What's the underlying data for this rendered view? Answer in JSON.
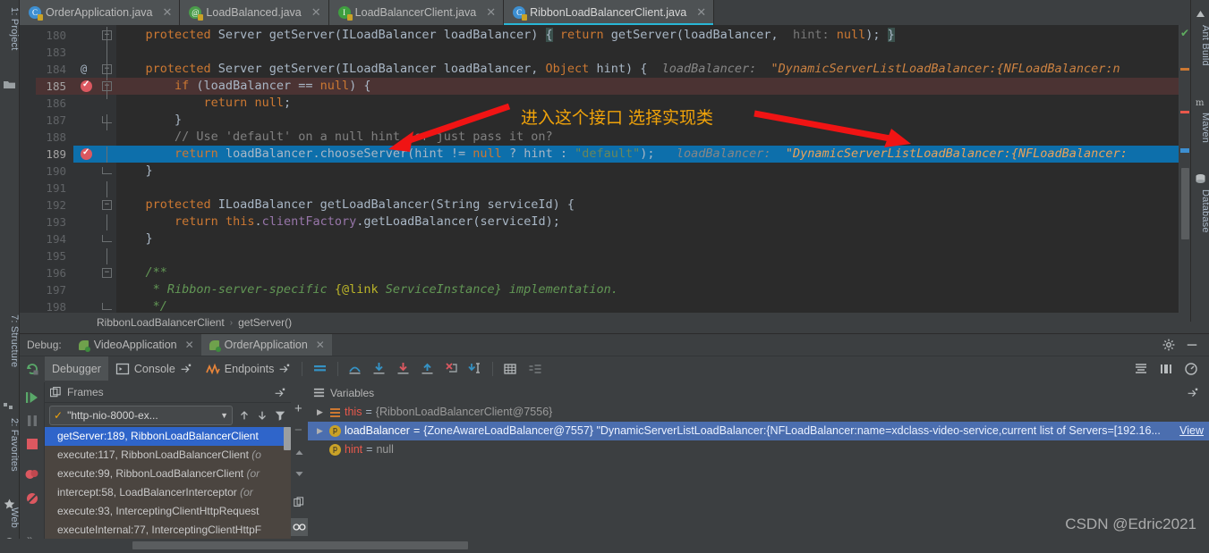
{
  "window": {
    "watermark": "CSDN @Edric2021"
  },
  "left_strip": {
    "items": [
      {
        "label": "1: Project",
        "icon": "folder-icon"
      },
      {
        "label": "7: Structure",
        "icon": "structure-icon"
      },
      {
        "label": "2: Favorites",
        "icon": "star-icon"
      },
      {
        "label": "Web",
        "icon": "globe-icon"
      }
    ]
  },
  "right_strip": {
    "items": [
      {
        "label": "Ant Build",
        "icon": "ant-icon"
      },
      {
        "label": "Maven",
        "icon": "maven-icon"
      },
      {
        "label": "Database",
        "icon": "database-icon"
      }
    ]
  },
  "tabs": [
    {
      "label": "OrderApplication.java",
      "icon": "spring-class-icon",
      "glyph": "C",
      "active": false
    },
    {
      "label": "LoadBalanced.java",
      "icon": "annotation-icon",
      "glyph": "@",
      "active": false
    },
    {
      "label": "LoadBalancerClient.java",
      "icon": "interface-icon",
      "glyph": "I",
      "active": false
    },
    {
      "label": "RibbonLoadBalancerClient.java",
      "icon": "class-icon",
      "glyph": "C",
      "active": true
    }
  ],
  "editor": {
    "lines": [
      {
        "num": "180",
        "fold": "plus",
        "marker": "",
        "segments": [
          {
            "t": "    ",
            "c": "id"
          },
          {
            "t": "protected",
            "c": "k"
          },
          {
            "t": " Server getServer(ILoadBalancer loadBalancer) ",
            "c": "id"
          },
          {
            "t": "{",
            "c": "brmatch"
          },
          {
            "t": " ",
            "c": "id"
          },
          {
            "t": "return",
            "c": "k"
          },
          {
            "t": " getServer(loadBalancer, ",
            "c": "id"
          },
          {
            "t": " hint:",
            "c": "hintp"
          },
          {
            "t": " ",
            "c": "id"
          },
          {
            "t": "null",
            "c": "k"
          },
          {
            "t": "); ",
            "c": "id"
          },
          {
            "t": "}",
            "c": "brmatch"
          }
        ]
      },
      {
        "num": "183",
        "fold": "",
        "marker": "",
        "segments": []
      },
      {
        "num": "184",
        "fold": "minus",
        "marker": "at",
        "segments": [
          {
            "t": "    ",
            "c": "id"
          },
          {
            "t": "protected",
            "c": "k"
          },
          {
            "t": " Server getServer(ILoadBalancer loadBalancer, ",
            "c": "id"
          },
          {
            "t": "Object",
            "c": "k"
          },
          {
            "t": " hint) {  ",
            "c": "id"
          },
          {
            "t": "loadBalancer:",
            "c": "dbg"
          },
          {
            "t": "  \"DynamicServerListLoadBalancer:{NFLoadBalancer:n",
            "c": "dbgv"
          }
        ]
      },
      {
        "num": "185",
        "fold": "minus",
        "marker": "breakpoint",
        "hl": "red",
        "segments": [
          {
            "t": "        ",
            "c": "id"
          },
          {
            "t": "if",
            "c": "k"
          },
          {
            "t": " (loadBalancer == ",
            "c": "id"
          },
          {
            "t": "null",
            "c": "k"
          },
          {
            "t": ") {",
            "c": "id"
          }
        ]
      },
      {
        "num": "186",
        "fold": "",
        "marker": "",
        "segments": [
          {
            "t": "            ",
            "c": "id"
          },
          {
            "t": "return",
            "c": "k"
          },
          {
            "t": " ",
            "c": "id"
          },
          {
            "t": "null",
            "c": "k"
          },
          {
            "t": ";",
            "c": "id"
          }
        ]
      },
      {
        "num": "187",
        "fold": "foldend",
        "marker": "",
        "segments": [
          {
            "t": "        }",
            "c": "id"
          }
        ]
      },
      {
        "num": "188",
        "fold": "",
        "marker": "",
        "segments": [
          {
            "t": "        ",
            "c": "id"
          },
          {
            "t": "// Use 'default' on a null hint, or just pass it on?",
            "c": "cmt"
          }
        ]
      },
      {
        "num": "189",
        "fold": "",
        "marker": "breakpoint",
        "hl": "blue",
        "segments": [
          {
            "t": "        ",
            "c": "id"
          },
          {
            "t": "return",
            "c": "k"
          },
          {
            "t": " loadBalancer.chooseServer(hint != ",
            "c": "id"
          },
          {
            "t": "null",
            "c": "k"
          },
          {
            "t": " ? hint : ",
            "c": "id"
          },
          {
            "t": "\"default\"",
            "c": "str"
          },
          {
            "t": ");   ",
            "c": "id"
          },
          {
            "t": "loadBalancer:",
            "c": "dbg"
          },
          {
            "t": "  \"DynamicServerListLoadBalancer:{NFLoadBalancer:",
            "c": "dbgv-sel"
          }
        ]
      },
      {
        "num": "190",
        "fold": "foldend",
        "marker": "",
        "segments": [
          {
            "t": "    }",
            "c": "id"
          }
        ]
      },
      {
        "num": "191",
        "fold": "",
        "marker": "",
        "segments": []
      },
      {
        "num": "192",
        "fold": "minus",
        "marker": "",
        "segments": [
          {
            "t": "    ",
            "c": "id"
          },
          {
            "t": "protected",
            "c": "k"
          },
          {
            "t": " ILoadBalancer getLoadBalancer(String serviceId) {",
            "c": "id"
          }
        ]
      },
      {
        "num": "193",
        "fold": "",
        "marker": "",
        "segments": [
          {
            "t": "        ",
            "c": "id"
          },
          {
            "t": "return",
            "c": "k"
          },
          {
            "t": " ",
            "c": "id"
          },
          {
            "t": "this",
            "c": "k"
          },
          {
            "t": ".",
            "c": "id"
          },
          {
            "t": "clientFactory",
            "c": "fld"
          },
          {
            "t": ".getLoadBalancer(serviceId);",
            "c": "id"
          }
        ]
      },
      {
        "num": "194",
        "fold": "foldend",
        "marker": "",
        "segments": [
          {
            "t": "    }",
            "c": "id"
          }
        ]
      },
      {
        "num": "195",
        "fold": "",
        "marker": "",
        "segments": []
      },
      {
        "num": "196",
        "fold": "minus",
        "marker": "",
        "segments": [
          {
            "t": "    /**",
            "c": "cm"
          }
        ]
      },
      {
        "num": "197",
        "fold": "",
        "marker": "",
        "segments": [
          {
            "t": "     * Ribbon-server-specific ",
            "c": "cm"
          },
          {
            "t": "{@link",
            "c": "annot"
          },
          {
            "t": " ServiceInstance} implementation.",
            "c": "cm"
          }
        ]
      },
      {
        "num": "198",
        "fold": "foldend",
        "marker": "",
        "segments": [
          {
            "t": "     */",
            "c": "cm"
          }
        ]
      }
    ]
  },
  "breadcrumb": {
    "class": "RibbonLoadBalancerClient",
    "separator": "›",
    "method": "getServer()"
  },
  "debug_bar": {
    "label": "Debug:",
    "tabs": [
      {
        "label": "VideoApplication",
        "active": false
      },
      {
        "label": "OrderApplication",
        "active": true
      }
    ],
    "settings_icon": "gear-icon",
    "minimize_icon": "minimize-icon"
  },
  "debug_toolbar": {
    "rerun_icon": "rerun-icon",
    "items": [
      {
        "label": "Debugger",
        "icon": "debugger-icon",
        "active": true
      },
      {
        "label": "Console",
        "icon": "console-icon",
        "active": false
      },
      {
        "label": "Endpoints",
        "icon": "endpoints-icon",
        "active": false
      }
    ],
    "action_icons": [
      "show-execution-point-icon",
      "step-over-icon",
      "step-into-icon",
      "force-step-into-icon",
      "step-out-icon",
      "drop-frame-icon",
      "run-to-cursor-icon",
      "evaluate-expression-icon",
      "layout-icon"
    ],
    "right_icons": [
      "restore-layout-icon",
      "settings-layout-icon",
      "mute-breakpoints-icon"
    ]
  },
  "run_controls": {
    "icons": [
      "resume-program-icon",
      "pause-program-icon",
      "stop-icon",
      "view-breakpoints-icon",
      "mute-breakpoints-icon",
      "more-icon"
    ]
  },
  "frames_panel": {
    "title": "Frames",
    "icon": "frames-icon",
    "settings_icon": "pin-icon",
    "thread": {
      "status_icon": "check-icon",
      "value": "\"http-nio-8000-ex...",
      "dropdown_icon": "chevron-down-icon"
    },
    "toolbar_icons": [
      "arrow-up-icon",
      "arrow-down-icon",
      "filter-icon"
    ],
    "frames": [
      {
        "method": "getServer:189, RibbonLoadBalancerClient",
        "detail": "",
        "selected": true
      },
      {
        "method": "execute:117, RibbonLoadBalancerClient ",
        "detail": "(o",
        "selected": false
      },
      {
        "method": "execute:99, RibbonLoadBalancerClient ",
        "detail": "(or",
        "selected": false
      },
      {
        "method": "intercept:58, LoadBalancerInterceptor ",
        "detail": "(or",
        "selected": false
      },
      {
        "method": "execute:93, InterceptingClientHttpRequest",
        "detail": "",
        "selected": false
      },
      {
        "method": "executeInternal:77, InterceptingClientHttpF",
        "detail": "",
        "selected": false
      }
    ]
  },
  "variables_panel": {
    "title": "Variables",
    "pin_icon": "pin-icon",
    "side_icons": [
      "add-watch-icon",
      "remove-watch-icon",
      "up-icon",
      "down-icon",
      "copy-icon",
      "inspect-icon"
    ],
    "variables": [
      {
        "expandable": true,
        "icon": "list-icon",
        "name": "this",
        "eq": "=",
        "value": "{RibbonLoadBalancerClient@7556}",
        "selected": false,
        "view_link": ""
      },
      {
        "expandable": true,
        "icon": "p-icon",
        "name": "loadBalancer",
        "eq": "=",
        "value": "{ZoneAwareLoadBalancer@7557} \"DynamicServerListLoadBalancer:{NFLoadBalancer:name=xdclass-video-service,current list of Servers=[192.16...",
        "selected": true,
        "view_link": "View"
      },
      {
        "expandable": false,
        "icon": "p-icon",
        "name": "hint",
        "eq": "=",
        "value": "null",
        "selected": false,
        "view_link": ""
      }
    ]
  },
  "annotation": {
    "text": "进入这个接口 选择实现类",
    "color": "#f0a30a",
    "arrow_color": "#f01414"
  },
  "colors": {
    "editor_bg": "#2b2b2b",
    "panel_bg": "#3c3f41",
    "gutter_bg": "#313335",
    "selection_blue": "#0d6fab",
    "breakpoint_red": "#4b3333",
    "frame_selected": "#2f65ca",
    "var_selected": "#4b6eaf",
    "accent": "#29b6d6"
  }
}
